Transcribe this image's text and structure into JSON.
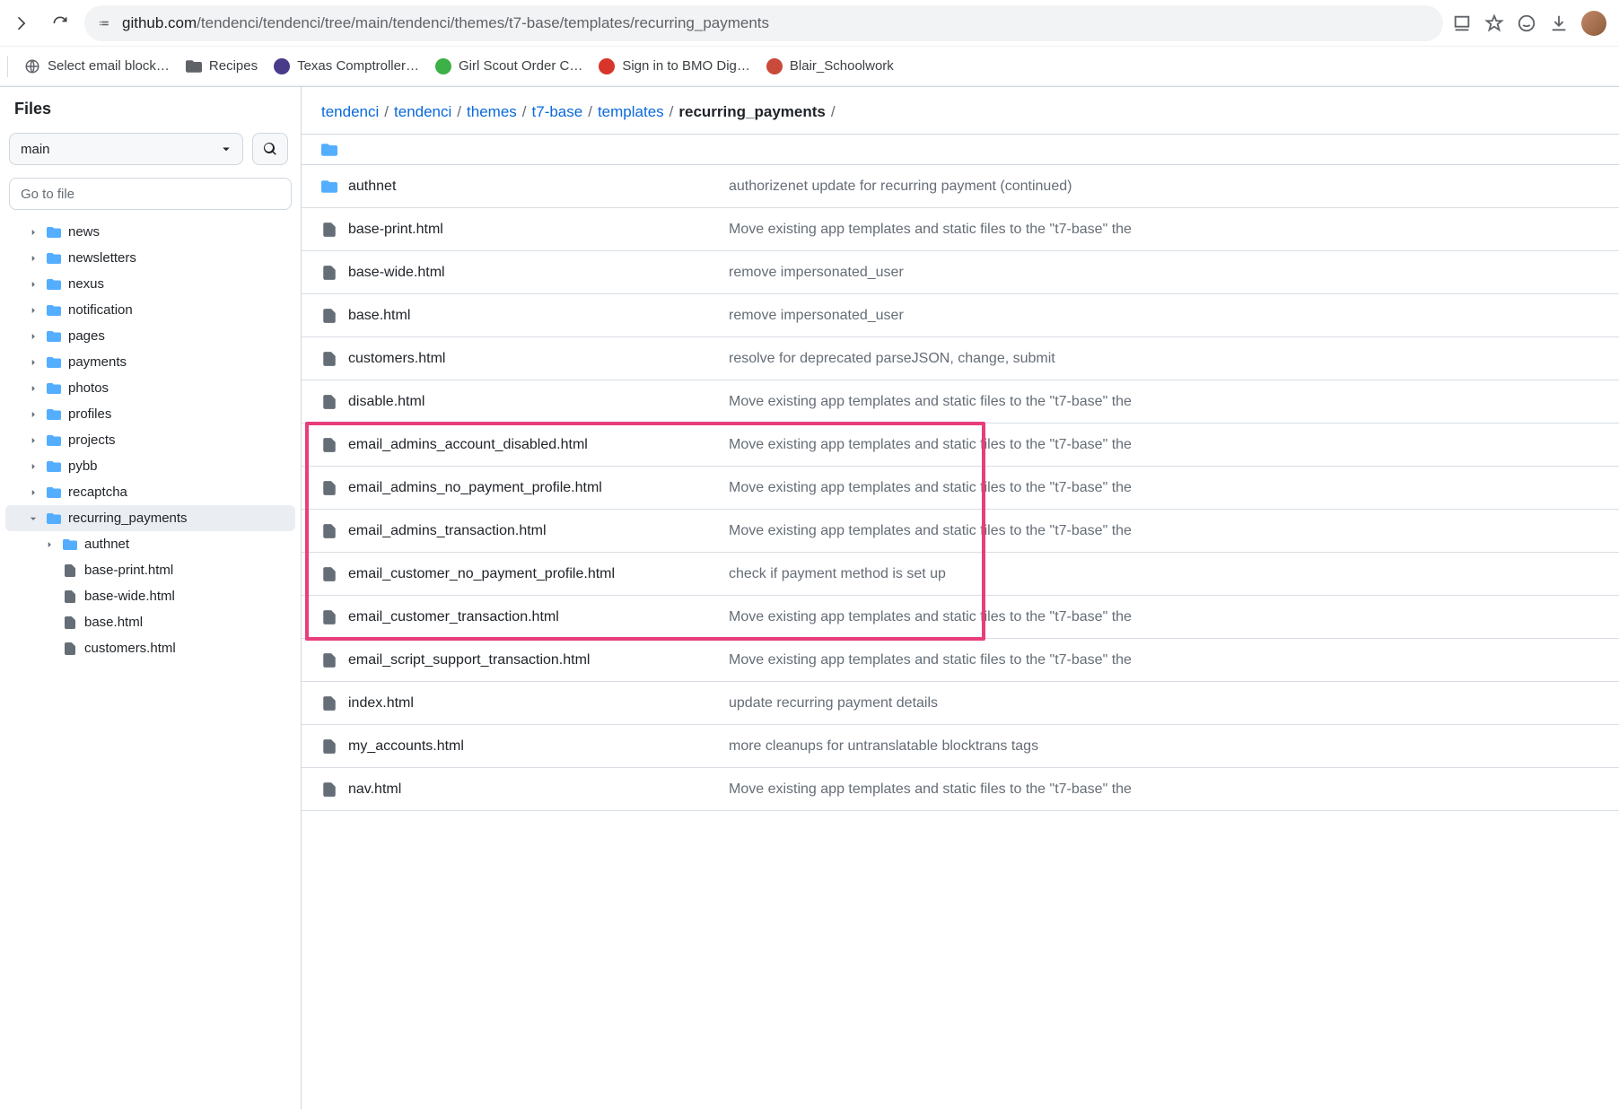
{
  "browser": {
    "url_host": "github.com",
    "url_path": "/tendenci/tendenci/tree/main/tendenci/themes/t7-base/templates/recurring_payments"
  },
  "bookmarks": [
    {
      "label": "Select email block…",
      "icon": "globe"
    },
    {
      "label": "Recipes",
      "icon": "folder"
    },
    {
      "label": "Texas Comptroller…",
      "icon": "purple"
    },
    {
      "label": "Girl Scout Order C…",
      "icon": "clover"
    },
    {
      "label": "Sign in to BMO Dig…",
      "icon": "red"
    },
    {
      "label": "Blair_Schoolwork",
      "icon": "wiki"
    }
  ],
  "sidebar": {
    "title": "Files",
    "branch": "main",
    "search_placeholder": "Go to file",
    "tree": [
      {
        "type": "folder",
        "name": "news",
        "depth": 1
      },
      {
        "type": "folder",
        "name": "newsletters",
        "depth": 1
      },
      {
        "type": "folder",
        "name": "nexus",
        "depth": 1
      },
      {
        "type": "folder",
        "name": "notification",
        "depth": 1
      },
      {
        "type": "folder",
        "name": "pages",
        "depth": 1
      },
      {
        "type": "folder",
        "name": "payments",
        "depth": 1
      },
      {
        "type": "folder",
        "name": "photos",
        "depth": 1
      },
      {
        "type": "folder",
        "name": "profiles",
        "depth": 1
      },
      {
        "type": "folder",
        "name": "projects",
        "depth": 1
      },
      {
        "type": "folder",
        "name": "pybb",
        "depth": 1
      },
      {
        "type": "folder",
        "name": "recaptcha",
        "depth": 1
      },
      {
        "type": "folder",
        "name": "recurring_payments",
        "depth": 1,
        "expanded": true,
        "selected": true
      },
      {
        "type": "folder",
        "name": "authnet",
        "depth": 2
      },
      {
        "type": "file",
        "name": "base-print.html",
        "depth": 2
      },
      {
        "type": "file",
        "name": "base-wide.html",
        "depth": 2
      },
      {
        "type": "file",
        "name": "base.html",
        "depth": 2
      },
      {
        "type": "file",
        "name": "customers.html",
        "depth": 2
      }
    ]
  },
  "breadcrumb": [
    {
      "label": "tendenci",
      "link": true
    },
    {
      "label": "tendenci",
      "link": true
    },
    {
      "label": "themes",
      "link": true
    },
    {
      "label": "t7-base",
      "link": true
    },
    {
      "label": "templates",
      "link": true
    },
    {
      "label": "recurring_payments",
      "link": false
    }
  ],
  "files": [
    {
      "type": "folder",
      "name": "authnet",
      "commit": "authorizenet update for recurring payment (continued)"
    },
    {
      "type": "file",
      "name": "base-print.html",
      "commit": "Move existing app templates and static files to the \"t7-base\" the"
    },
    {
      "type": "file",
      "name": "base-wide.html",
      "commit": "remove impersonated_user"
    },
    {
      "type": "file",
      "name": "base.html",
      "commit": "remove impersonated_user"
    },
    {
      "type": "file",
      "name": "customers.html",
      "commit": "resolve for deprecated parseJSON, change, submit"
    },
    {
      "type": "file",
      "name": "disable.html",
      "commit": "Move existing app templates and static files to the \"t7-base\" the"
    },
    {
      "type": "file",
      "name": "email_admins_account_disabled.html",
      "commit": "Move existing app templates and static files to the \"t7-base\" the",
      "hl": true
    },
    {
      "type": "file",
      "name": "email_admins_no_payment_profile.html",
      "commit": "Move existing app templates and static files to the \"t7-base\" the",
      "hl": true
    },
    {
      "type": "file",
      "name": "email_admins_transaction.html",
      "commit": "Move existing app templates and static files to the \"t7-base\" the",
      "hl": true
    },
    {
      "type": "file",
      "name": "email_customer_no_payment_profile.html",
      "commit": "check if payment method is set up",
      "hl": true
    },
    {
      "type": "file",
      "name": "email_customer_transaction.html",
      "commit": "Move existing app templates and static files to the \"t7-base\" the",
      "hl": true
    },
    {
      "type": "file",
      "name": "email_script_support_transaction.html",
      "commit": "Move existing app templates and static files to the \"t7-base\" the"
    },
    {
      "type": "file",
      "name": "index.html",
      "commit": "update recurring payment details"
    },
    {
      "type": "file",
      "name": "my_accounts.html",
      "commit": "more cleanups for untranslatable blocktrans tags"
    },
    {
      "type": "file",
      "name": "nav.html",
      "commit": "Move existing app templates and static files to the \"t7-base\" the"
    }
  ]
}
